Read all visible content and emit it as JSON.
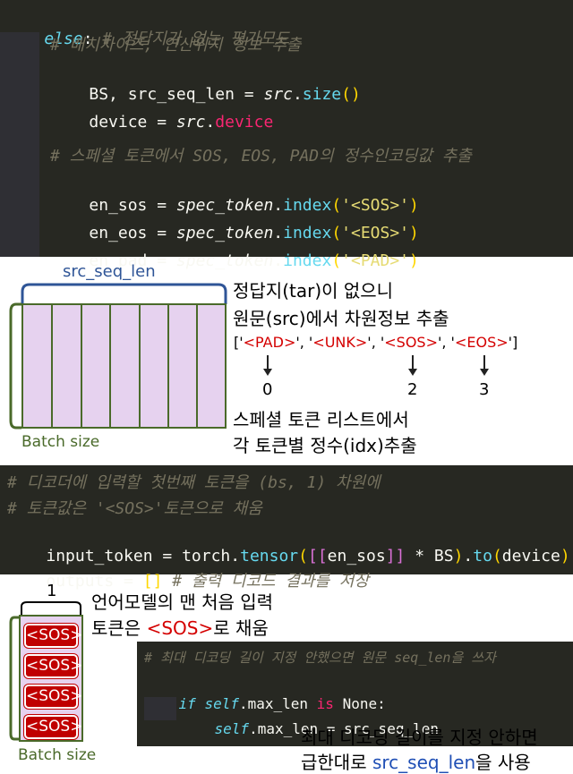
{
  "code1": {
    "l1_kw": "else",
    "l1_colon": ":",
    "l1_comment": " # 정답지가 없는 평가모드",
    "l2_comment": "# 배치사이즈, 연산위치 정보 추출",
    "l3_a": "BS, src_seq_len = ",
    "l3_b": "src",
    "l3_c": ".",
    "l3_d": "size",
    "l3_e": "()",
    "l4_a": "device = ",
    "l4_b": "src",
    "l4_c": ".",
    "l4_d": "device",
    "l5_comment": "# 스페셜 토큰에서 SOS, EOS, PAD의 정수인코딩값 추출",
    "l6_a": "en_sos = ",
    "l7_a": "en_eos = ",
    "l8_a": "en_pad = ",
    "spec": "spec_token",
    "dot": ".",
    "index": "index",
    "paren_open": "(",
    "paren_close": ")",
    "sos_str": "'<SOS>'",
    "eos_str": "'<EOS>'",
    "pad_str": "'<PAD>'"
  },
  "diagram1": {
    "top_label": "src_seq_len",
    "left_label": "Batch size",
    "note1_line1": "정답지(tar)이 없으니",
    "note1_line2": "원문(src)에서 차원정보 추출",
    "tokens_open": "['",
    "tok_pad": "<PAD>",
    "tok_sep": "', '",
    "tok_unk": "<UNK>",
    "tok_sos": "<SOS>",
    "tok_eos": "<EOS>",
    "tokens_close": "']",
    "idx0": "0",
    "idx2": "2",
    "idx3": "3",
    "note2_line1": "스페셜 토큰 리스트에서",
    "note2_line2": "각 토큰별 정수(idx)추출"
  },
  "code2": {
    "l1_comment": "# 디코더에 입력할 첫번째 토큰을 (bs, 1) 차원에",
    "l2_comment": "# 토큰값은 '<SOS>'토큰으로 채움",
    "l3_a": "input_token = torch",
    "l3_b": ".",
    "l3_c": "tensor",
    "l3_d": "(",
    "l3_e": "[[",
    "l3_f": "en_sos",
    "l3_g": "]]",
    "l3_h": " * BS",
    "l3_i": ")",
    "l3_j": ".",
    "l3_k": "to",
    "l3_l": "(",
    "l3_m": "device",
    "l3_n": ")",
    "l4_a": "outputs = ",
    "l4_b": "[]",
    "l4_c": " # 출력 디코드 결과를 저장"
  },
  "diagram2": {
    "top_label": "1",
    "left_label": "Batch size",
    "sos": [
      "<SOS>",
      "<SOS>",
      "<SOS>",
      "<SOS>"
    ],
    "note_line1": "언어모델의 맨 처음 입력",
    "note_line2_a": "토큰은 ",
    "note_line2_b": "<SOS>",
    "note_line2_c": "로 채움"
  },
  "code3": {
    "l1_comment": "# 최대 디코딩 길이 지정 안했으면 원문 seq_len을 쓰자",
    "l2_if": "if",
    "l2_self": "self",
    "l2_rest": ".max_len ",
    "l2_is": "is",
    "l2_none": " None:",
    "l3_self": "self",
    "l3_rest": ".max_len = src_seq_len"
  },
  "note3": {
    "line1": "최대 디코딩 길이를 지정 안하면",
    "line2_a": "급한대로 ",
    "line2_b": "src_seq_len",
    "line2_c": "을 사용"
  },
  "colors": {
    "code_bg": "#272822",
    "matrix_fill": "#e6d2ef",
    "matrix_border": "#4a6a2a",
    "brace": "#2f5597",
    "sos_box": "#c00000",
    "highlight_red": "#d40000",
    "highlight_blue": "#1f4fb5"
  }
}
